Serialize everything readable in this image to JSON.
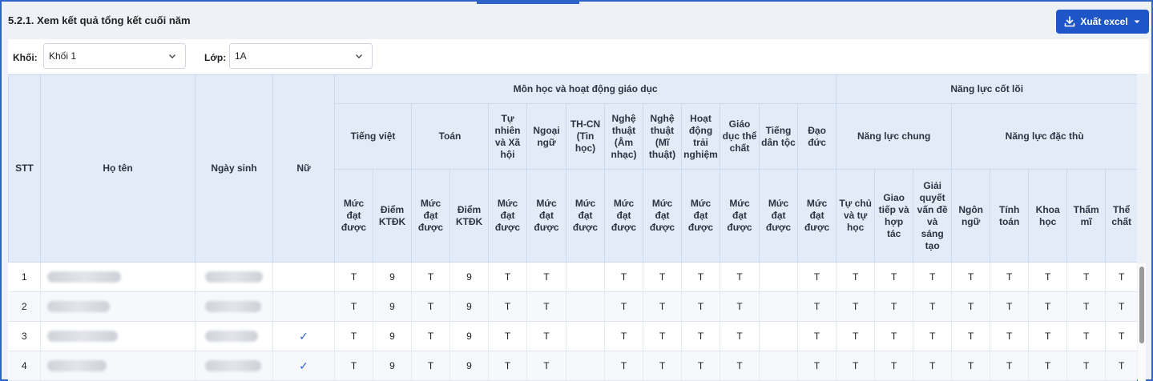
{
  "page": {
    "section_title": "5.2.1. Xem kết quả tổng kết cuối năm",
    "export_label": "Xuất excel"
  },
  "filters": {
    "grade_label": "Khối:",
    "grade_value": "Khối 1",
    "class_label": "Lớp:",
    "class_value": "1A"
  },
  "table": {
    "headers": {
      "stt": "STT",
      "name": "Họ tên",
      "dob": "Ngày sinh",
      "female": "Nữ",
      "subjects_group": "Môn học và hoạt động giáo dục",
      "competency_group": "Năng lực cốt lõi",
      "general_competency": "Năng lực chung",
      "specific_competency": "Năng lực đặc thù",
      "subjects": [
        "Tiếng việt",
        "Toán",
        "Tự nhiên và Xã hội",
        "Ngoại ngữ",
        "TH-CN (Tin học)",
        "Nghệ thuật (Âm nhạc)",
        "Nghệ thuật (Mĩ thuật)",
        "Hoạt động trải nghiệm",
        "Giáo dục thể chất",
        "Tiếng dân tộc",
        "Đạo đức"
      ],
      "level": "Mức đạt được",
      "score": "Điểm KTĐK",
      "general_items": [
        "Tự chủ và tự học",
        "Giao tiếp và hợp tác",
        "Giải quyết vấn đề và sáng tạo"
      ],
      "specific_items": [
        "Ngôn ngữ",
        "Tính toán",
        "Khoa học",
        "Thẩm mĩ",
        "Thể chất"
      ]
    },
    "rows": [
      {
        "stt": "1",
        "female": "",
        "cells": [
          "T",
          "9",
          "T",
          "9",
          "T",
          "T",
          "",
          "T",
          "T",
          "T",
          "T",
          "",
          "T",
          "T",
          "T",
          "T",
          "T",
          "T",
          "T",
          "T",
          "T"
        ]
      },
      {
        "stt": "2",
        "female": "",
        "cells": [
          "T",
          "9",
          "T",
          "9",
          "T",
          "T",
          "",
          "T",
          "T",
          "T",
          "T",
          "",
          "T",
          "T",
          "T",
          "T",
          "T",
          "T",
          "T",
          "T",
          "T"
        ]
      },
      {
        "stt": "3",
        "female": "✓",
        "cells": [
          "T",
          "9",
          "T",
          "9",
          "T",
          "T",
          "",
          "T",
          "T",
          "T",
          "T",
          "",
          "T",
          "T",
          "T",
          "T",
          "T",
          "T",
          "T",
          "T",
          "T"
        ]
      },
      {
        "stt": "4",
        "female": "✓",
        "cells": [
          "T",
          "9",
          "T",
          "9",
          "T",
          "T",
          "",
          "T",
          "T",
          "T",
          "T",
          "",
          "T",
          "T",
          "T",
          "T",
          "T",
          "T",
          "T",
          "T",
          "T"
        ]
      }
    ]
  },
  "colors": {
    "accent": "#1e56c8",
    "frame": "#2f63c8",
    "header_bg": "#e3ebf8"
  },
  "icons": {
    "export": "download-icon",
    "export_menu": "caret-down-icon",
    "select_chevron": "chevron-down-icon",
    "female_mark": "checkmark-icon"
  }
}
